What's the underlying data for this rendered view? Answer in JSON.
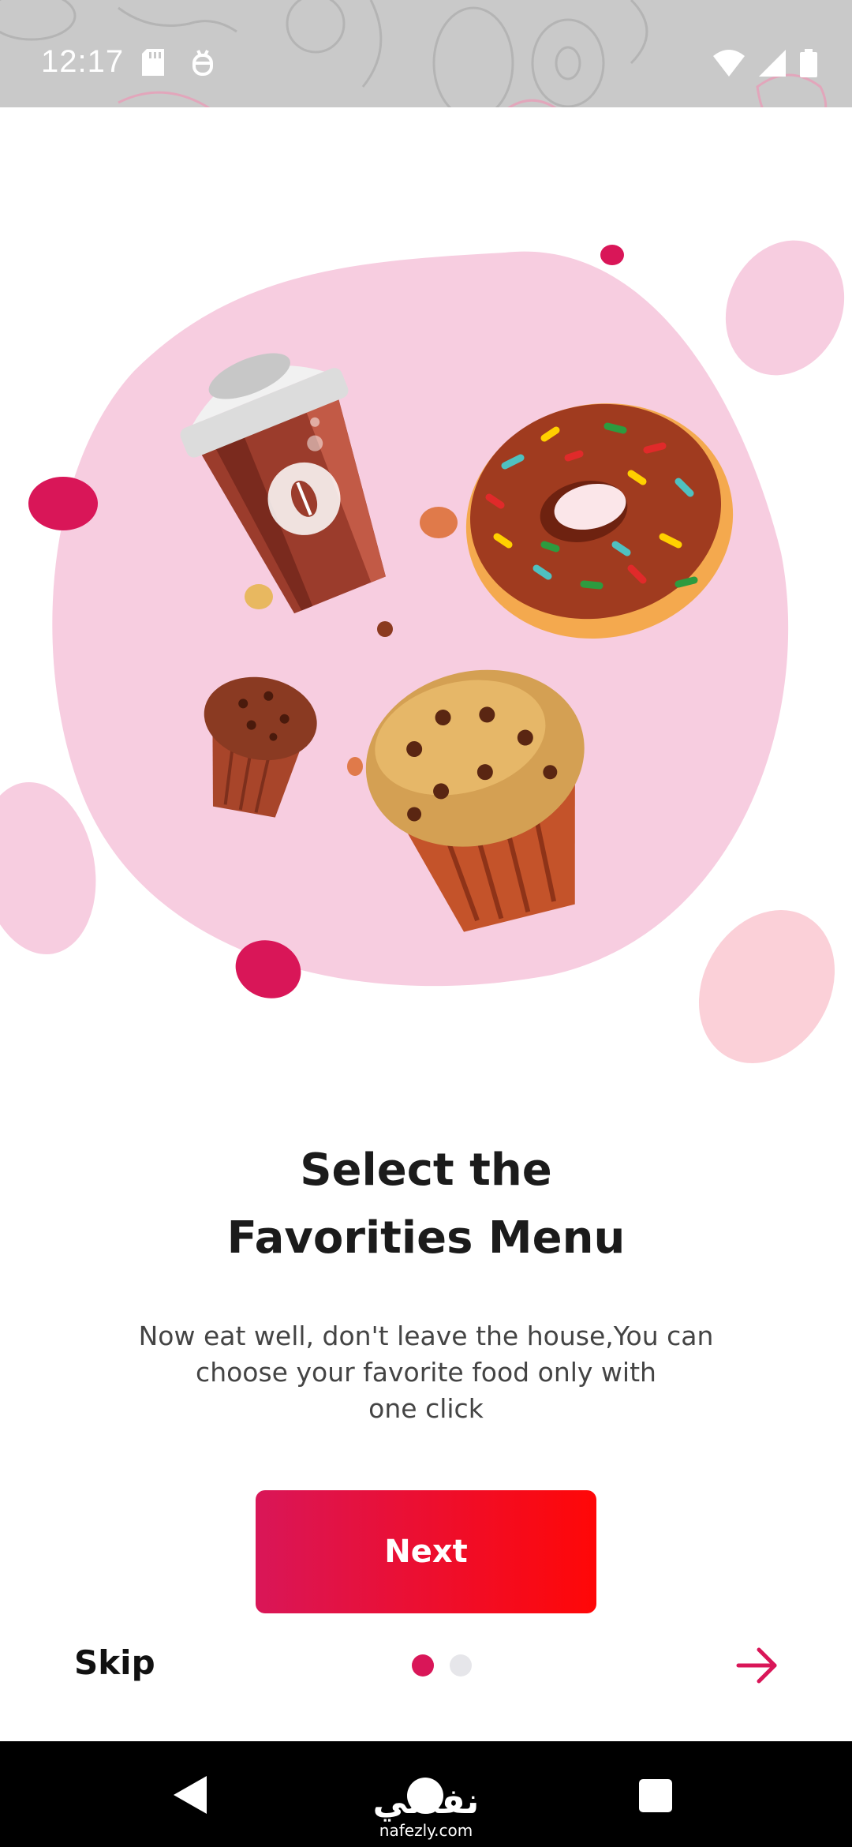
{
  "status_bar": {
    "time": "12:17",
    "left_icons": [
      "sd-card-icon",
      "debug-icon"
    ],
    "right_icons": [
      "wifi-icon",
      "cell-signal-icon",
      "battery-icon"
    ]
  },
  "onboarding": {
    "title_line1": "Select the",
    "title_line2": "Favorities Menu",
    "subtitle_line1": "Now eat well, don't leave the house,You can",
    "subtitle_line2": "choose your favorite food only with",
    "subtitle_line3": "one click",
    "next_label": "Next",
    "skip_label": "Skip",
    "page_count": 2,
    "active_page": 1
  },
  "colors": {
    "accent": "#d91658",
    "accent_end": "#ff0707",
    "blob_pink": "#f7cde0"
  },
  "nav_bar": {
    "icons": [
      "back-icon",
      "home-icon",
      "recents-icon"
    ]
  },
  "watermark": {
    "arabic": "نفذلي",
    "latin": "nafezly.com"
  }
}
